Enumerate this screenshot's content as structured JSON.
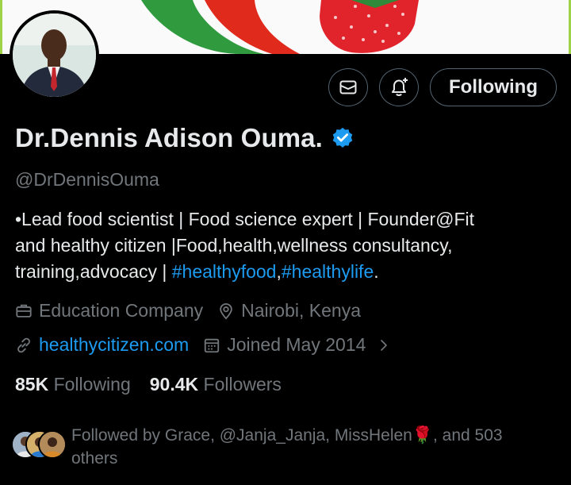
{
  "profile": {
    "name": "Dr.Dennis Adison Ouma.",
    "handle": "@DrDennisOuma",
    "verified": true,
    "bio": {
      "line1": "•Lead food scientist | Food science expert | Founder@Fit",
      "line2": "and healthy citizen |Food,health,wellness consultancy,",
      "line3_text": "training,advocacy | ",
      "tag1": "#healthyfood",
      "comma": ",",
      "tag2": "#healthylife",
      "period": "."
    },
    "category": "Education Company",
    "location": "Nairobi, Kenya",
    "website": "healthycitizen.com",
    "joined": "Joined May 2014"
  },
  "actions": {
    "follow_label": "Following",
    "message_icon": "envelope-icon",
    "notify_icon": "bell-plus-icon"
  },
  "stats": {
    "following_count": "85K",
    "following_label": "Following",
    "followers_count": "90.4K",
    "followers_label": "Followers"
  },
  "followed_by": {
    "text_before": "Followed by Grace, @Janja_Janja, MissHelen",
    "emoji": "🌹",
    "text_after": ", and 503 others"
  },
  "colors": {
    "background": "#000000",
    "text": "#e7e9ea",
    "muted": "#71767b",
    "link": "#1d9bf0",
    "border": "#536471"
  }
}
